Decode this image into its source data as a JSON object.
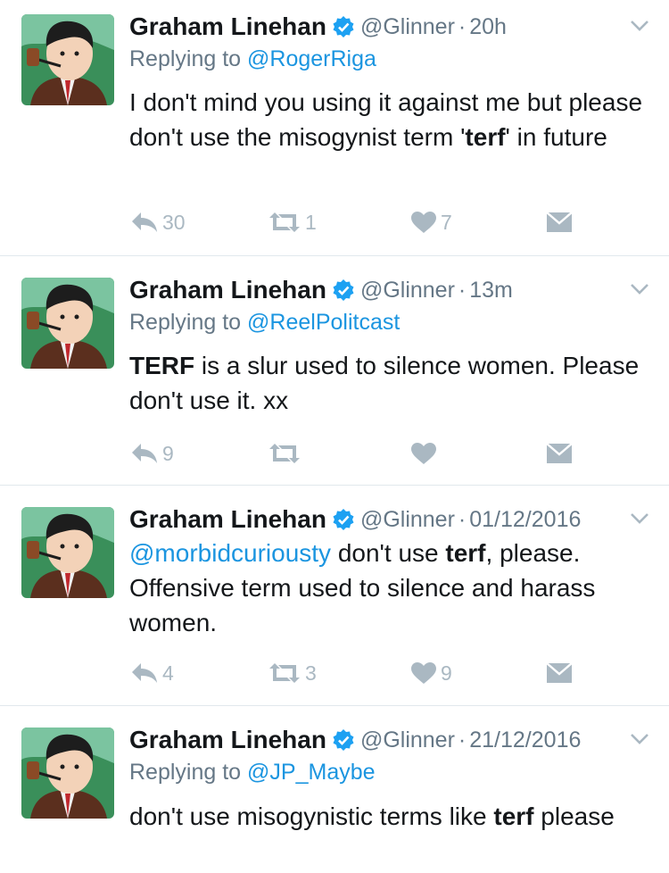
{
  "author": {
    "name": "Graham Linehan",
    "handle": "@Glinner"
  },
  "tweets": [
    {
      "time": "20h",
      "reply_prefix": "Replying to ",
      "reply_to": "@RogerRiga",
      "text_parts": [
        "I don't mind you using it against me but please don't use the misogynist term '",
        "terf",
        "' in future"
      ],
      "replies": "30",
      "retweets": "1",
      "likes": "7"
    },
    {
      "time": "13m",
      "reply_prefix": "Replying to ",
      "reply_to": "@ReelPolitcast",
      "text_parts": [
        "TERF",
        " is a slur used to silence women. Please don't use it. xx"
      ],
      "replies": "9",
      "retweets": "",
      "likes": ""
    },
    {
      "time": "01/12/2016",
      "mention": "@morbidcuriousty",
      "text_parts": [
        " don't use ",
        "terf",
        ", please. Offensive term used to silence and harass women."
      ],
      "replies": "4",
      "retweets": "3",
      "likes": "9"
    },
    {
      "time": "21/12/2016",
      "reply_prefix": "Replying to ",
      "reply_to": "@JP_Maybe",
      "text_parts": [
        "don't use misogynistic terms like ",
        "terf",
        " please"
      ]
    }
  ],
  "icons": {
    "reply": "reply-icon",
    "retweet": "retweet-icon",
    "like": "heart-icon",
    "dm": "envelope-icon",
    "verified": "verified-badge-icon",
    "chevron": "chevron-down-icon"
  },
  "colors": {
    "link": "#1b95e0",
    "muted": "#657786",
    "icon": "#aab8c2",
    "divider": "#e1e8ed"
  }
}
